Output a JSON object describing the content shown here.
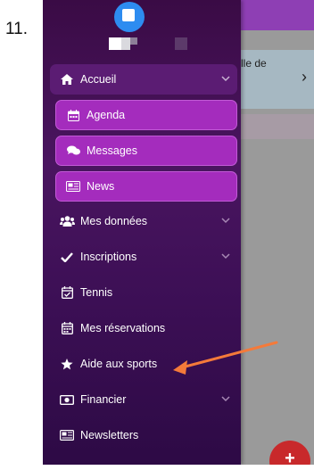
{
  "step_label": "11.",
  "background_app": {
    "card_text": "lle de",
    "chevron": "›",
    "fab_label": "+"
  },
  "menu": {
    "accueil": "Accueil",
    "agenda": "Agenda",
    "messages": "Messages",
    "news": "News",
    "mes_donnees": "Mes données",
    "inscriptions": "Inscriptions",
    "tennis": "Tennis",
    "mes_reservations": "Mes réservations",
    "aide_aux_sports": "Aide aux sports",
    "financier": "Financier",
    "newsletters": "Newsletters"
  },
  "colors": {
    "drawer": "#4a1560",
    "submenu": "#a42cbd",
    "annotation_arrow": "#f47a3a",
    "fab": "#c8292b"
  },
  "icons": [
    "home-icon",
    "calendar-icon",
    "chat-icon",
    "newspaper-icon",
    "users-icon",
    "check-icon",
    "calendar-check-icon",
    "calendar-icon",
    "star-icon",
    "money-icon",
    "newsletter-icon",
    "chevron-down-icon",
    "plus-icon"
  ]
}
